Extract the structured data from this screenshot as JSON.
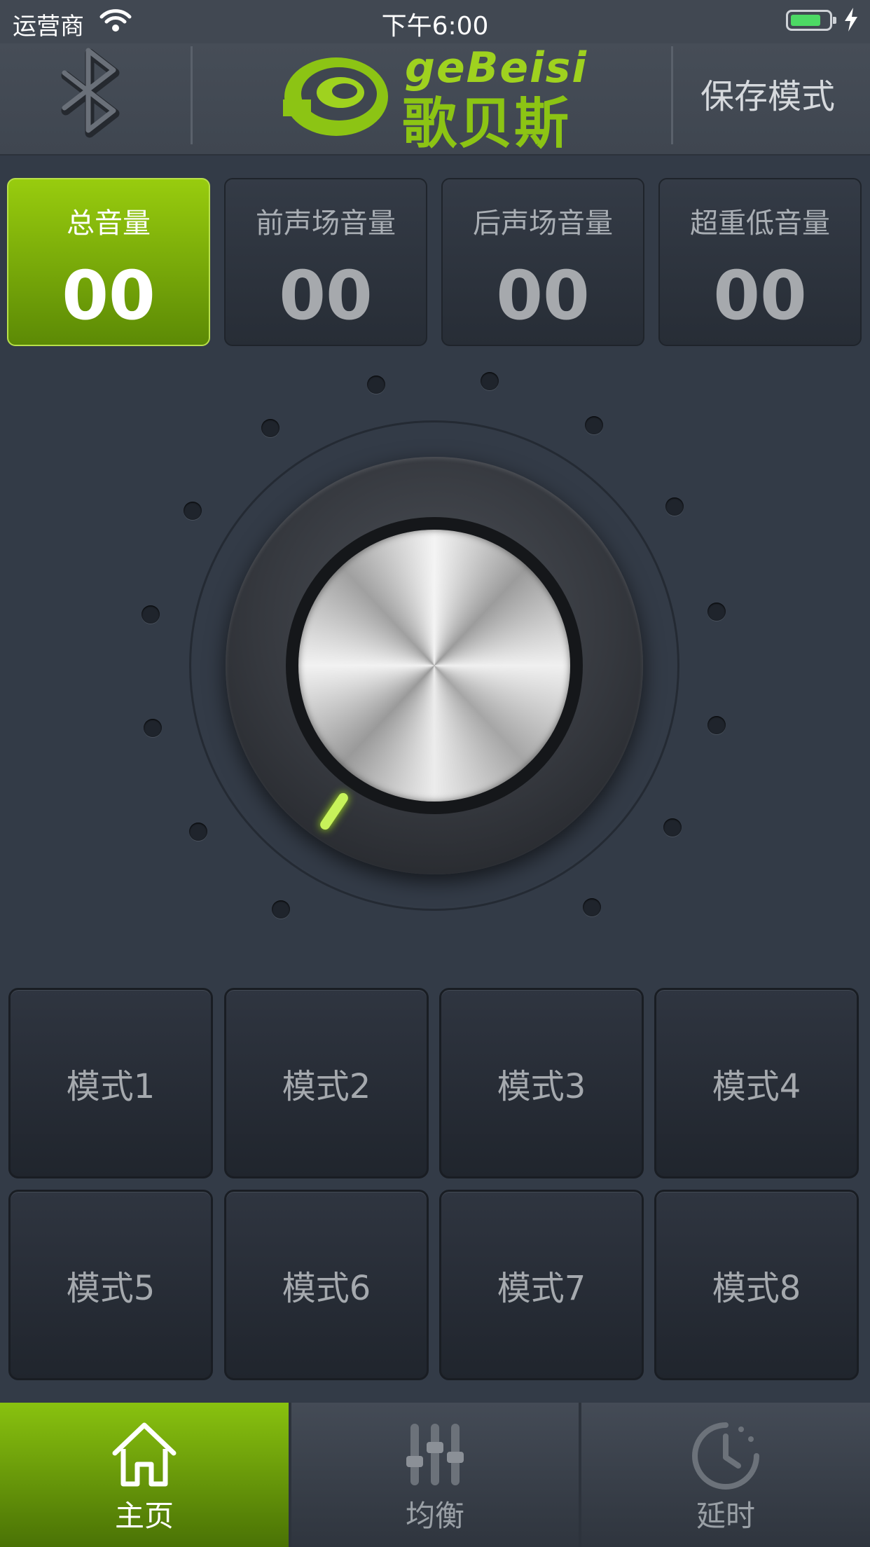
{
  "status_bar": {
    "carrier": "运营商",
    "time": "下午6:00",
    "battery_level": 0.8
  },
  "header": {
    "bluetooth_icon": "bluetooth-icon",
    "logo_brand": "geBeisi",
    "logo_cn": "歌贝斯",
    "save_mode_label": "保存模式",
    "accent_color": "#8cc414"
  },
  "volumes": [
    {
      "label": "总音量",
      "value": "00",
      "active": true
    },
    {
      "label": "前声场音量",
      "value": "00",
      "active": false
    },
    {
      "label": "后声场音量",
      "value": "00",
      "active": false
    },
    {
      "label": "超重低音量",
      "value": "00",
      "active": false
    }
  ],
  "knob": {
    "level": 0,
    "indicator_color": "#c7f25a"
  },
  "modes": [
    "模式1",
    "模式2",
    "模式3",
    "模式4",
    "模式5",
    "模式6",
    "模式7",
    "模式8"
  ],
  "tabs": [
    {
      "label": "主页",
      "icon": "home-icon",
      "active": true
    },
    {
      "label": "均衡",
      "icon": "equalizer-icon",
      "active": false
    },
    {
      "label": "延时",
      "icon": "clock-icon",
      "active": false
    }
  ]
}
